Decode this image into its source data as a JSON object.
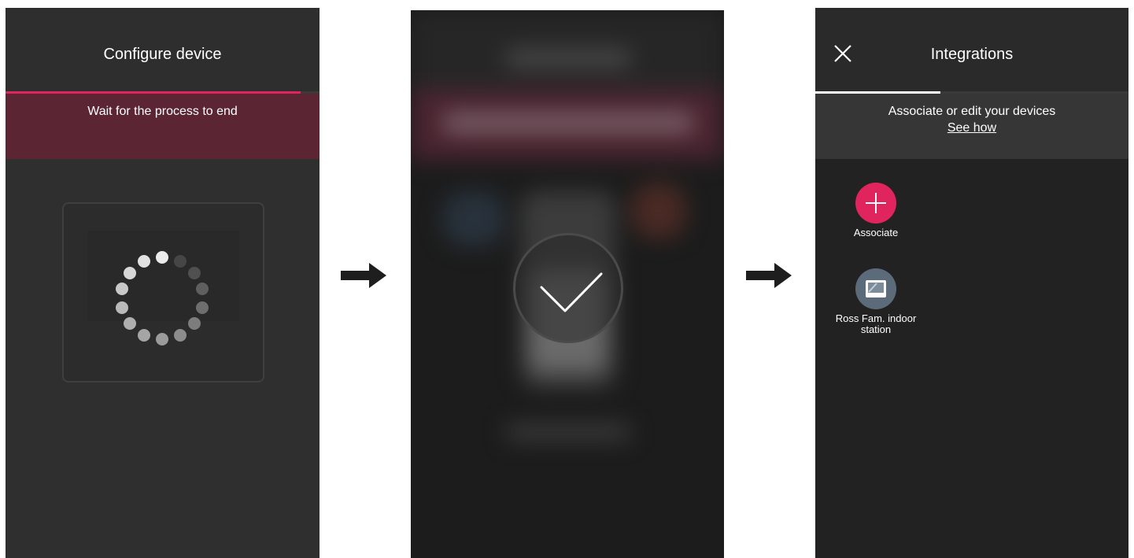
{
  "screen1": {
    "title": "Configure device",
    "progress_percent": 94,
    "banner_text": "Wait for the process to end",
    "colors": {
      "accent": "#e0245e",
      "banner": "#5c2533"
    }
  },
  "arrows": [
    "arrow-right-icon",
    "arrow-right-icon"
  ],
  "screen2": {
    "icon": "checkmark-icon"
  },
  "screen3": {
    "title": "Integrations",
    "close_icon": "close-icon",
    "info_text": "Associate or edit your devices",
    "info_link": "See how",
    "tab_percent": 40,
    "tiles": [
      {
        "label": "Associate",
        "icon": "plus-icon",
        "color": "#e0245e"
      },
      {
        "label": "Ross Fam. indoor station",
        "icon": "indoor-station-icon",
        "color": "#5b6b7a"
      }
    ]
  }
}
